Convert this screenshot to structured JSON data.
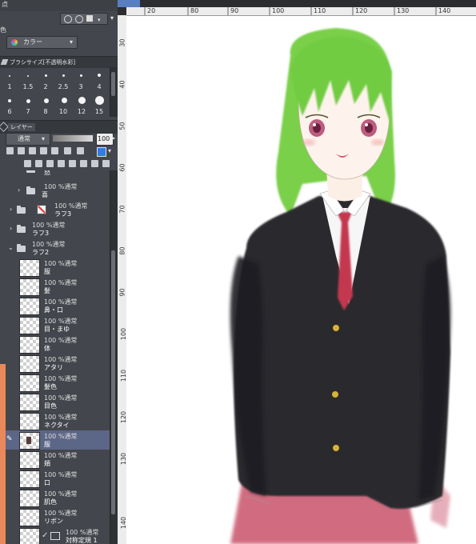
{
  "colors": {
    "panel": "#43464c",
    "selected_row": "#5c6686",
    "accent_rail": "#e9885a",
    "hair": "#6fcf3b",
    "jacket": "#2b2b2d",
    "skirt": "#c9526a",
    "tie": "#c4394f"
  },
  "top": {
    "frag_top": "点",
    "color_section_label": "色",
    "color_mode_value": "カラー"
  },
  "brush_size": {
    "title": "ブラシサイズ[不透明水彩]",
    "sizes": [
      "1",
      "1.5",
      "2",
      "2.5",
      "3",
      "4",
      "6",
      "7",
      "8",
      "10",
      "12",
      "15"
    ]
  },
  "layer_panel": {
    "title": "レイヤー",
    "blend_mode": "通常",
    "opacity": "100",
    "layers": [
      {
        "mode": "",
        "name": "怒"
      },
      {
        "mode": "100 %通常",
        "name": "喜"
      },
      {
        "mode": "100 %通常",
        "name": "ラフ3"
      },
      {
        "mode": "100 %通常",
        "name": "ラフ3"
      },
      {
        "mode": "100 %通常",
        "name": "ラフ2"
      },
      {
        "mode": "100 %通常",
        "name": "服"
      },
      {
        "mode": "100 %通常",
        "name": "髪"
      },
      {
        "mode": "100 %通常",
        "name": "鼻・口"
      },
      {
        "mode": "100 %通常",
        "name": "目・まゆ"
      },
      {
        "mode": "100 %通常",
        "name": "体"
      },
      {
        "mode": "100 %通常",
        "name": "アタリ"
      },
      {
        "mode": "100 %通常",
        "name": "髪色"
      },
      {
        "mode": "100 %通常",
        "name": "目色"
      },
      {
        "mode": "100 %通常",
        "name": "ネクタイ"
      },
      {
        "mode": "100 %通常",
        "name": "服"
      },
      {
        "mode": "100 %通常",
        "name": "頬"
      },
      {
        "mode": "100 %通常",
        "name": "口"
      },
      {
        "mode": "100 %通常",
        "name": "肌色"
      },
      {
        "mode": "100 %通常",
        "name": "リボン"
      },
      {
        "mode": "100 %通常",
        "name": "対称定規 1"
      }
    ]
  },
  "ruler": {
    "top": [
      "20",
      "80",
      "90",
      "100",
      "110",
      "120",
      "130",
      "140"
    ],
    "left": [
      "30",
      "40",
      "50",
      "60",
      "70",
      "80",
      "90",
      "100",
      "110",
      "120",
      "130",
      "140"
    ]
  }
}
